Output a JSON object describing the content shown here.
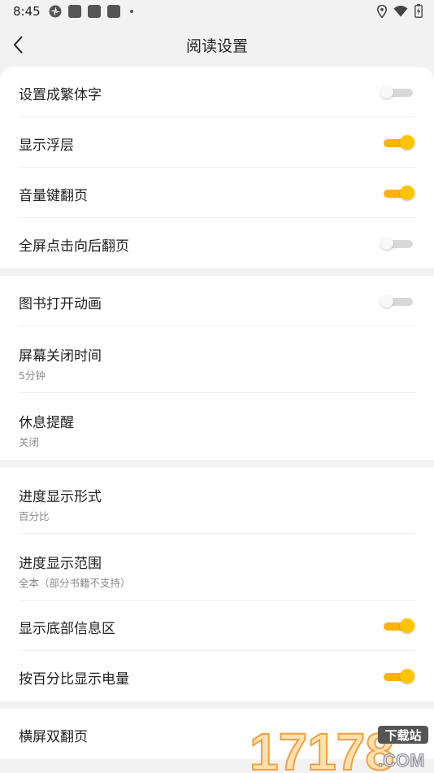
{
  "status_bar": {
    "time": "8:45",
    "icons": [
      "pinwheel-icon",
      "app-icon",
      "app-icon",
      "app-icon",
      "dot-icon",
      "location-icon",
      "wifi-icon",
      "battery-charging-icon"
    ]
  },
  "header": {
    "title": "阅读设置",
    "back_icon": "chevron-left-icon"
  },
  "colors": {
    "accent": "#ffc400",
    "toggle_off": "#d8d8d8"
  },
  "groups": [
    {
      "items": [
        {
          "label": "设置成繁体字",
          "toggle": false
        },
        {
          "label": "显示浮层",
          "toggle": true
        },
        {
          "label": "音量键翻页",
          "toggle": true
        },
        {
          "label": "全屏点击向后翻页",
          "toggle": false
        }
      ]
    },
    {
      "items": [
        {
          "label": "图书打开动画",
          "toggle": false
        },
        {
          "label": "屏幕关闭时间",
          "value": "5分钟"
        },
        {
          "label": "休息提醒",
          "value": "关闭"
        }
      ]
    },
    {
      "items": [
        {
          "label": "进度显示形式",
          "value": "百分比"
        },
        {
          "label": "进度显示范围",
          "value": "全本（部分书籍不支持）"
        },
        {
          "label": "显示底部信息区",
          "toggle": true
        },
        {
          "label": "按百分比显示电量",
          "toggle": true
        }
      ]
    },
    {
      "items": [
        {
          "label": "横屏双翻页"
        }
      ]
    }
  ],
  "watermark": {
    "number": "17178",
    "tag": "下载站",
    "domain": ".COM"
  }
}
